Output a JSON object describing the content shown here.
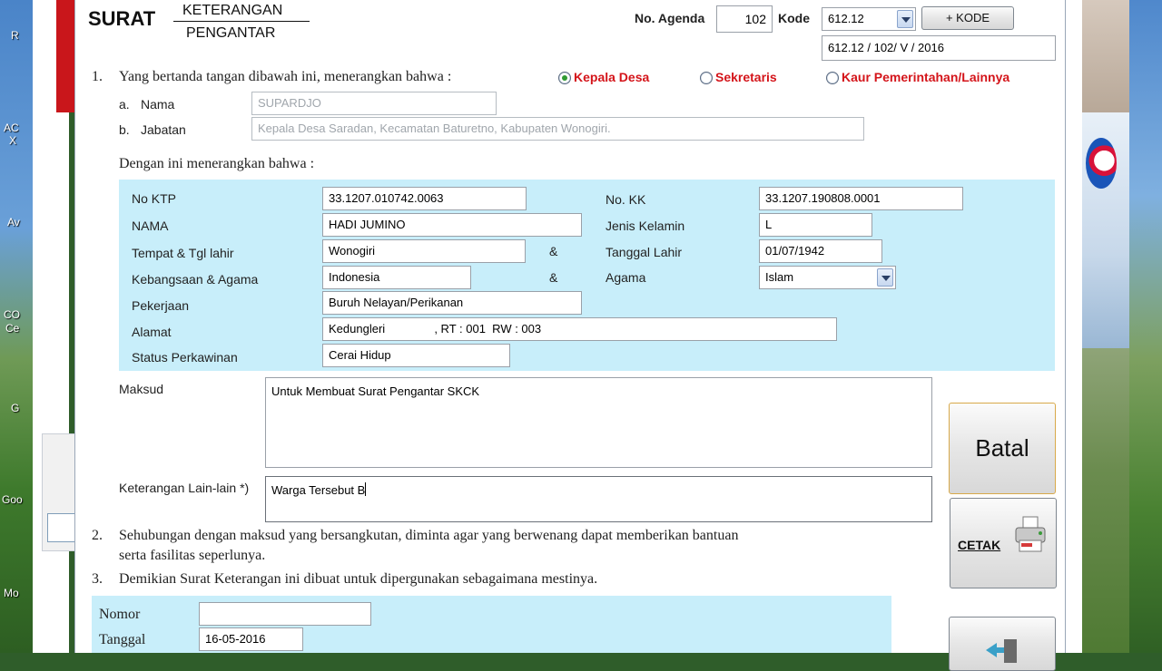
{
  "desktop": {
    "left_labels": [
      "R",
      "AC",
      "X",
      "Av",
      "CO",
      "Ce",
      "G",
      "Goo",
      "Mo"
    ]
  },
  "header": {
    "surat": "SURAT",
    "title_top": "KETERANGAN",
    "title_bottom": "PENGANTAR",
    "agenda_label": "No. Agenda",
    "agenda_value": "102",
    "kode_label": "Kode",
    "kode_value": "612.12",
    "kode_button": "+ KODE",
    "nomor_surat": "612.12  /    102/ V / 2016"
  },
  "section1": {
    "number": "1.",
    "text": "Yang bertanda tangan dibawah ini, menerangkan bahwa :",
    "radios": [
      {
        "label": "Kepala Desa",
        "checked": true
      },
      {
        "label": "Sekretaris",
        "checked": false
      },
      {
        "label": "Kaur Pemerintahan/Lainnya",
        "checked": false
      }
    ],
    "nama_prefix": "a.",
    "nama_label": "Nama",
    "nama_value": "SUPARDJO",
    "jabatan_prefix": "b.",
    "jabatan_label": "Jabatan",
    "jabatan_value": "Kepala Desa Saradan, Kecamatan Baturetno, Kabupaten Wonogiri."
  },
  "intro": "Dengan ini menerangkan bahwa :",
  "person": {
    "ktp_label": "No KTP",
    "ktp_value": "33.1207.010742.0063",
    "kk_label": "No. KK",
    "kk_value": "33.1207.190808.0001",
    "nama_label": "NAMA",
    "nama_value": "HADI JUMINO",
    "jk_label": "Jenis Kelamin",
    "jk_value": "L",
    "ttl_label": "Tempat & Tgl lahir",
    "tempat_value": "Wonogiri",
    "amp1": "&",
    "tgl_label": "Tanggal Lahir",
    "tgl_value": "01/07/1942",
    "bangsa_label": "Kebangsaan & Agama",
    "bangsa_value": "Indonesia",
    "amp2": "&",
    "agama_label": "Agama",
    "agama_value": "Islam",
    "kerja_label": "Pekerjaan",
    "kerja_value": "Buruh Nelayan/Perikanan",
    "alamat_label": "Alamat",
    "alamat_value": "Kedungleri               , RT : 001  RW : 003",
    "status_label": "Status Perkawinan",
    "status_value": "Cerai Hidup"
  },
  "maksud": {
    "label": "Maksud",
    "value": "Untuk Membuat Surat Pengantar SKCK"
  },
  "keterangan": {
    "label": "Keterangan Lain-lain *)",
    "value": "Warga Tersebut B"
  },
  "section2": {
    "number": "2.",
    "line1": "Sehubungan dengan maksud yang bersangkutan, diminta agar yang berwenang dapat memberikan bantuan",
    "line2": "serta fasilitas seperlunya."
  },
  "section3": {
    "number": "3.",
    "text": "Demikian Surat Keterangan ini dibuat untuk dipergunakan sebagaimana mestinya."
  },
  "footer": {
    "nomor_label": "Nomor",
    "nomor_value": "",
    "tanggal_label": "Tanggal",
    "tanggal_value": "16-05-2016"
  },
  "buttons": {
    "batal": "Batal",
    "cetak": "CETAK"
  }
}
